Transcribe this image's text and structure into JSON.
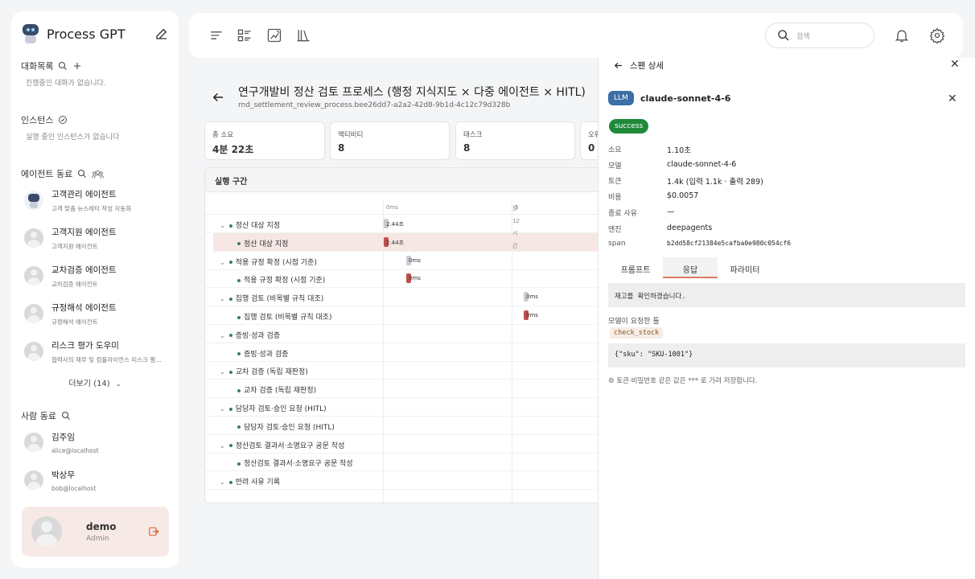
{
  "brand": {
    "title": "Process GPT"
  },
  "sidebar": {
    "conversations": {
      "label": "대화목록",
      "empty": "진행중인 대화가 없습니다."
    },
    "instances": {
      "label": "인스턴스",
      "empty": "실행 중인 인스턴스가 없습니다"
    },
    "agents": {
      "label": "에이전트 동료",
      "items": [
        {
          "name": "고객관리 에이전트",
          "desc": "고객 맞춤 뉴스레터 작성 자동화"
        },
        {
          "name": "고객지원 에이전트",
          "desc": "고객지원 에이전트"
        },
        {
          "name": "교차검증 에이전트",
          "desc": "교차검증 에이전트"
        },
        {
          "name": "규정해석 에이전트",
          "desc": "규정해석 에이전트"
        },
        {
          "name": "리스크 평가 도우미",
          "desc": "협력사의 재무 및 컴플라이언스 리스크 평가 ..."
        }
      ],
      "more": "더보기 (14)"
    },
    "people": {
      "label": "사람 동료",
      "items": [
        {
          "name": "김주임",
          "email": "alice@localhost"
        },
        {
          "name": "박상무",
          "email": "bob@localhost"
        }
      ]
    },
    "user": {
      "name": "demo",
      "role": "Admin"
    }
  },
  "topbar": {
    "search_placeholder": "검색"
  },
  "process": {
    "title": "연구개발비 정산 검토 프로세스 (행정 지식지도 × 다중 에이전트 × HITL)",
    "id": "rnd_settlement_review_process.bee26dd7-a2a2-42d8-9b1d-4c12c79d328b",
    "stats": [
      {
        "label": "총 소요",
        "value": "4분 22초"
      },
      {
        "label": "액티비티",
        "value": "8"
      },
      {
        "label": "태스크",
        "value": "8"
      },
      {
        "label": "오류",
        "value": "0"
      }
    ]
  },
  "gantt": {
    "title": "실행 구간",
    "ticks": [
      "0ms",
      "5"
    ],
    "vertical_text": [
      "원",
      "12",
      "시",
      "간"
    ],
    "rows": [
      {
        "label": "정산 대상 지정",
        "group": true,
        "bar": "gray",
        "value": "2.44초"
      },
      {
        "label": "정산 대상 지정",
        "group": false,
        "bar": "red",
        "value": "2.44초",
        "selected": true
      },
      {
        "label": "적용 규정 확정 (시점 기준)",
        "group": true,
        "bar": "gray",
        "value": "0ms"
      },
      {
        "label": "적용 규정 확정 (시점 기준)",
        "group": false,
        "bar": "red",
        "value": "0ms"
      },
      {
        "label": "집행 검토 (비목별 규칙 대조)",
        "group": true,
        "bar": "gray",
        "value": "0ms"
      },
      {
        "label": "집행 검토 (비목별 규칙 대조)",
        "group": false,
        "bar": "red",
        "value": "0ms"
      },
      {
        "label": "증빙·성과 검증",
        "group": true,
        "bar": "",
        "value": ""
      },
      {
        "label": "증빙·성과 검증",
        "group": false,
        "bar": "",
        "value": ""
      },
      {
        "label": "교차 검증 (독립 재판정)",
        "group": true,
        "bar": "",
        "value": ""
      },
      {
        "label": "교차 검증 (독립 재판정)",
        "group": false,
        "bar": "",
        "value": ""
      },
      {
        "label": "담당자 검토·승인 요청 (HITL)",
        "group": true,
        "bar": "",
        "value": ""
      },
      {
        "label": "담당자 검토·승인 요청 (HITL)",
        "group": false,
        "bar": "",
        "value": ""
      },
      {
        "label": "정산검토 결과서·소명요구 공문 작성",
        "group": true,
        "bar": "",
        "value": ""
      },
      {
        "label": "정산검토 결과서·소명요구 공문 작성",
        "group": false,
        "bar": "",
        "value": ""
      },
      {
        "label": "반려 사유 기록",
        "group": true,
        "bar": "",
        "value": ""
      }
    ]
  },
  "span": {
    "header": "스팬 상세",
    "badge": "LLM",
    "model": "claude-sonnet-4-6",
    "status": "success",
    "fields": [
      {
        "key": "소요",
        "value": "1.10초"
      },
      {
        "key": "모델",
        "value": "claude-sonnet-4-6"
      },
      {
        "key": "토큰",
        "value": "1.4k (입력 1.1k · 출력 289)"
      },
      {
        "key": "비용",
        "value": "$0.0057"
      },
      {
        "key": "종료 사유",
        "value": "—"
      },
      {
        "key": "엔진",
        "value": "deepagents"
      },
      {
        "key": "span",
        "value": "b2dd58cf21384e5cafba0e980c054cf6"
      }
    ],
    "tabs": [
      "프롬프트",
      "응답",
      "파라미터"
    ],
    "active_tab": "응답",
    "response_text": "재고를 확인하겠습니다.",
    "tool_heading": "모델이 요청한 툴",
    "tool_name": "check_stock",
    "tool_args": "{\"sku\": \"SKU-1001\"}",
    "mask_note": "토큰·비밀번호 같은 값은 *** 로 가려 저장합니다."
  }
}
